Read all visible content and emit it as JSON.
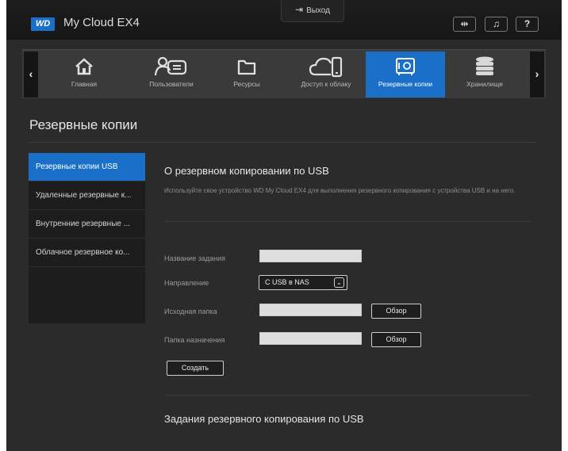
{
  "header": {
    "logo": "WD",
    "app_title": "My Cloud EX4",
    "logout_label": "Выход",
    "buttons": [
      "usb-icon",
      "bell-icon",
      "help-icon"
    ],
    "help_label": "?"
  },
  "nav": {
    "items": [
      {
        "label": "Главная",
        "icon": "home-icon"
      },
      {
        "label": "Пользователи",
        "icon": "users-icon"
      },
      {
        "label": "Ресурсы",
        "icon": "folder-icon"
      },
      {
        "label": "Доступ к облаку",
        "icon": "cloud-access-icon"
      },
      {
        "label": "Резервные копии",
        "icon": "safe-icon",
        "active": true
      },
      {
        "label": "Хранилище",
        "icon": "storage-icon"
      }
    ]
  },
  "page": {
    "title": "Резервные копии"
  },
  "sidebar": {
    "items": [
      {
        "label": "Резервные копии USB",
        "active": true
      },
      {
        "label": "Удаленные резервные к..."
      },
      {
        "label": "Внутренние резервные ..."
      },
      {
        "label": "Облачное резервное ко..."
      }
    ]
  },
  "content": {
    "section_title": "О резервном копировании по USB",
    "description": "Используйте свое устройство WD My Cloud EX4 для выполнения резервного копирования с устройства USB и на него.",
    "form": {
      "job_name_label": "Название задания",
      "job_name_value": "",
      "direction_label": "Направление",
      "direction_value": "С USB в NAS",
      "source_label": "Исходная папка",
      "source_value": "",
      "dest_label": "Папка назначения",
      "dest_value": "",
      "browse_label": "Обзор",
      "create_label": "Создать"
    },
    "jobs_title": "Задания резервного копирования по USB"
  },
  "colors": {
    "accent": "#1a6fc9",
    "background": "#2b2b2b",
    "sidebar": "#1d1d1d"
  }
}
